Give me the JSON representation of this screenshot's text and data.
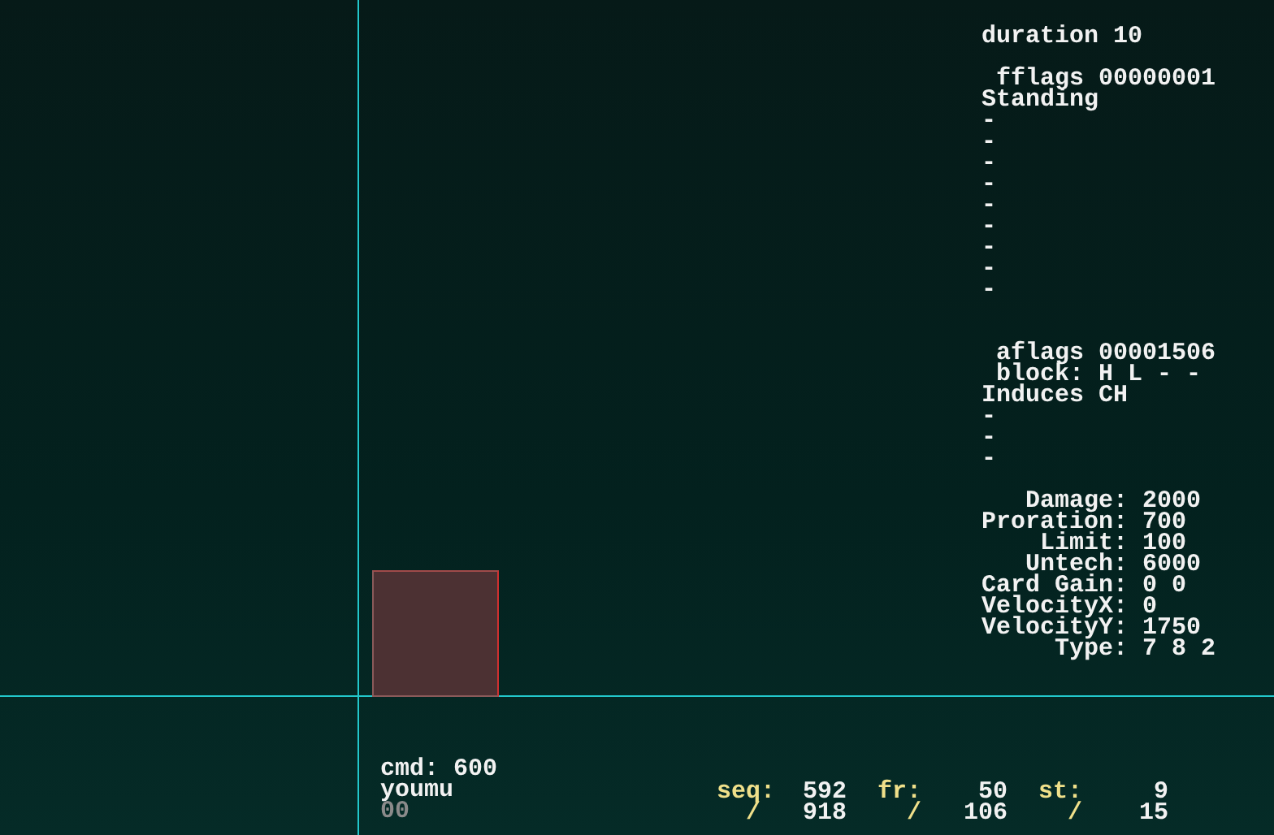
{
  "frame_flags": {
    "duration": "duration 10",
    "fflags": "fflags 00000001",
    "flags": [
      "Standing",
      "-",
      "-",
      "-",
      "-",
      "-",
      "-",
      "-",
      "-",
      "-"
    ]
  },
  "attack_flags": {
    "aflags": "aflags 00001506",
    "block": "block: H L - -",
    "flags": [
      "Induces CH",
      "-",
      "-",
      "-"
    ]
  },
  "stats": [
    {
      "label": "Damage:",
      "value": "2000"
    },
    {
      "label": "Proration:",
      "value": "700"
    },
    {
      "label": "Limit:",
      "value": "100"
    },
    {
      "label": "Untech:",
      "value": "6000"
    },
    {
      "label": "Card Gain:",
      "value": "0 0"
    },
    {
      "label": "VelocityX:",
      "value": "0"
    },
    {
      "label": "VelocityY:",
      "value": "1750"
    },
    {
      "label": "Type:",
      "value": "7 8 2"
    }
  ],
  "character": {
    "cmd": "cmd: 600",
    "name": "youmu",
    "palette": "00"
  },
  "counters": [
    {
      "label": "seq:",
      "current": "592",
      "separator": "/",
      "total": "918"
    },
    {
      "label": "fr:",
      "current": "50",
      "separator": "/",
      "total": "106"
    },
    {
      "label": "st:",
      "current": "9",
      "separator": "/",
      "total": "15"
    }
  ]
}
